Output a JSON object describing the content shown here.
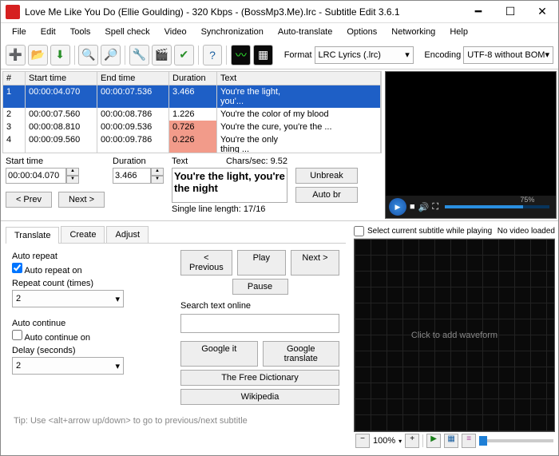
{
  "title": "Love Me Like You Do (Ellie Goulding) - 320 Kbps - (BossMp3.Me).lrc - Subtitle Edit 3.6.1",
  "menu": [
    "File",
    "Edit",
    "Tools",
    "Spell check",
    "Video",
    "Synchronization",
    "Auto-translate",
    "Options",
    "Networking",
    "Help"
  ],
  "format_label": "Format",
  "format_value": "LRC Lyrics (.lrc)",
  "encoding_label": "Encoding",
  "encoding_value": "UTF-8 without BOM",
  "cols": {
    "num": "#",
    "start": "Start time",
    "end": "End time",
    "dur": "Duration",
    "text": "Text"
  },
  "rows": [
    {
      "n": "1",
      "s": "00:00:04.070",
      "e": "00:00:07.536",
      "d": "3.466",
      "t": "You're the light,<br />you'...",
      "sel": true
    },
    {
      "n": "2",
      "s": "00:00:07.560",
      "e": "00:00:08.786",
      "d": "1.226",
      "t": "You're the color of my blood"
    },
    {
      "n": "3",
      "s": "00:00:08.810",
      "e": "00:00:09.536",
      "d": "0.726",
      "t": "You're the cure, you're the ...",
      "warn": true
    },
    {
      "n": "4",
      "s": "00:00:09.560",
      "e": "00:00:09.786",
      "d": "0.226",
      "t": "You're the only<br />thing ...",
      "warn": true
    }
  ],
  "start_label": "Start time",
  "start_value": "00:00:04.070",
  "dur_label": "Duration",
  "dur_value": "3.466",
  "text_label": "Text",
  "chars_label": "Chars/sec: 9.52",
  "text_value": "You're the light,\nyou're the night",
  "sll": "Single line length: 17/16",
  "unbreak": "Unbreak",
  "autobr": "Auto br",
  "prev": "< Prev",
  "next": "Next >",
  "vid_pct": "75%",
  "tabs": {
    "t": "Translate",
    "c": "Create",
    "a": "Adjust"
  },
  "ar": "Auto repeat",
  "aron": "Auto repeat on",
  "rc": "Repeat count (times)",
  "rcv": "2",
  "ac": "Auto continue",
  "acon": "Auto continue on",
  "ds": "Delay (seconds)",
  "dsv": "2",
  "pb": "< Previous",
  "play": "Play",
  "nb": "Next >",
  "pause": "Pause",
  "sto": "Search text online",
  "gi": "Google it",
  "gt": "Google translate",
  "tfd": "The Free Dictionary",
  "wp": "Wikipedia",
  "tip": "Tip: Use <alt+arrow up/down> to go to previous/next subtitle",
  "selcur": "Select current subtitle while playing",
  "novid": "No video loaded",
  "wave": "Click to add waveform",
  "zoom": "100%"
}
